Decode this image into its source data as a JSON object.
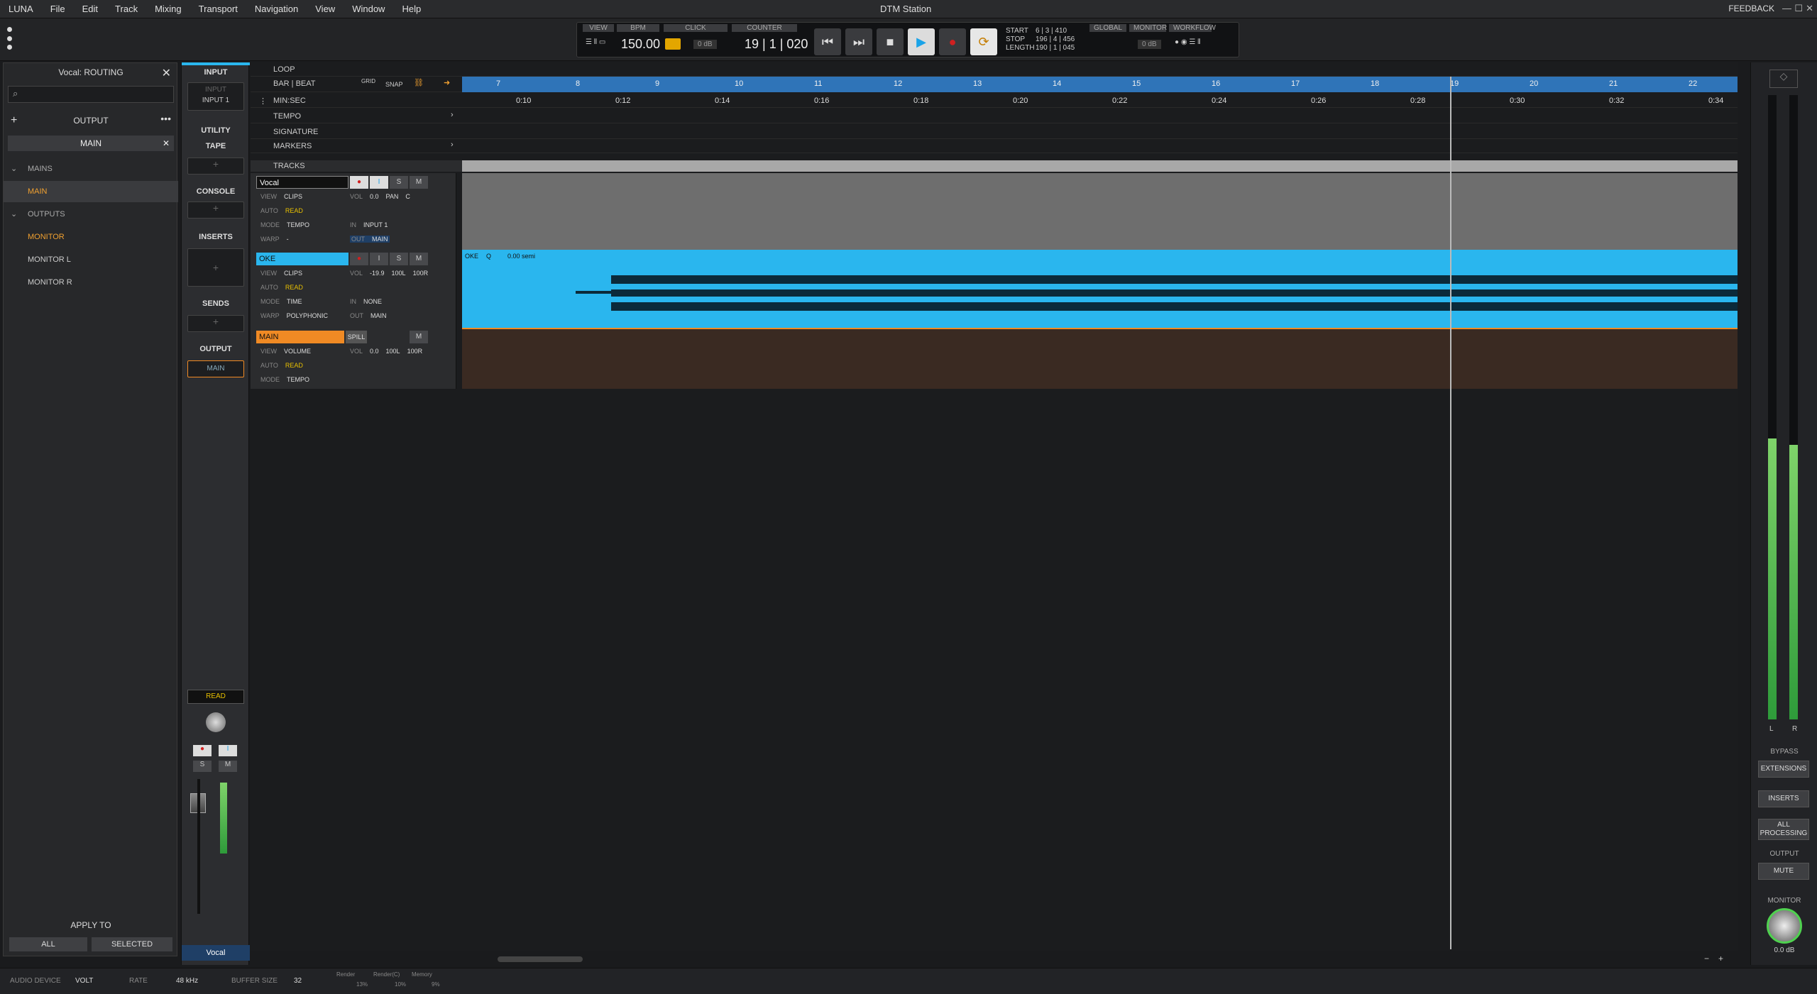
{
  "menu": [
    "LUNA",
    "File",
    "Edit",
    "Track",
    "Mixing",
    "Transport",
    "Navigation",
    "View",
    "Window",
    "Help"
  ],
  "window_title": "DTM Station",
  "feedback": "FEEDBACK",
  "transport": {
    "view": "VIEW",
    "bpm_label": "BPM",
    "bpm": "150.00",
    "click_label": "CLICK",
    "click_db": "0 dB",
    "counter_label": "COUNTER",
    "counter": "19 | 1 | 020",
    "start_label": "START",
    "stop_label": "STOP",
    "length_label": "LENGTH",
    "start": "6 | 3 | 410",
    "stop": "196 | 4 | 456",
    "length": "190 | 1 | 045",
    "global_label": "GLOBAL",
    "monitor_label": "MONITOR",
    "workflow_label": "WORKFLOW",
    "monitor_db": "0 dB"
  },
  "left": {
    "title": "Vocal: ROUTING",
    "output": "OUTPUT",
    "main_sel": "MAIN",
    "mains": "MAINS",
    "main": "MAIN",
    "outputs": "OUTPUTS",
    "monitor": "MONITOR",
    "monitor_l": "MONITOR L",
    "monitor_r": "MONITOR R",
    "apply_to": "APPLY TO",
    "all": "ALL",
    "selected": "SELECTED"
  },
  "strip": {
    "input": "INPUT",
    "input_slot": "INPUT",
    "input1": "INPUT 1",
    "utility": "UTILITY",
    "tape": "TAPE",
    "console": "CONSOLE",
    "inserts": "INSERTS",
    "sends": "SENDS",
    "output": "OUTPUT",
    "out_main": "MAIN",
    "read": "READ",
    "name": "Vocal"
  },
  "rulers": {
    "loop": "LOOP",
    "barbeat": "BAR | BEAT",
    "grid": "GRID",
    "snap": "SNAP",
    "minsec": "MIN:SEC",
    "tempo": "TEMPO",
    "signature": "SIGNATURE",
    "markers": "MARKERS",
    "tracks": "TRACKS"
  },
  "bars": [
    "7",
    "8",
    "9",
    "10",
    "11",
    "12",
    "13",
    "14",
    "15",
    "16",
    "17",
    "18",
    "19",
    "20",
    "21",
    "22"
  ],
  "times": [
    "0:10",
    "0:12",
    "0:14",
    "0:16",
    "0:18",
    "0:20",
    "0:22",
    "0:24",
    "0:26",
    "0:28",
    "0:30",
    "0:32",
    "0:34"
  ],
  "tracks": [
    {
      "name": "Vocal",
      "color": "#ffffff",
      "view": "CLIPS",
      "auto": "READ",
      "mode": "TEMPO",
      "warp": "-",
      "vol": "0.0",
      "pan": "PAN",
      "panval": "C",
      "in": "INPUT 1",
      "out": "MAIN"
    },
    {
      "name": "OKE",
      "color": "#2ab6ee",
      "view": "CLIPS",
      "auto": "READ",
      "mode": "TIME",
      "warp": "POLYPHONIC",
      "vol": "-19.9",
      "panl": "100L",
      "panr": "100R",
      "in": "NONE",
      "out": "MAIN",
      "clip_name": "OKE",
      "clip_q": "Q",
      "clip_pitch": "0.00 semi"
    },
    {
      "name": "MAIN",
      "color": "#f08a24",
      "spill": "SPILL",
      "view": "VOLUME",
      "auto": "READ",
      "mode": "TEMPO",
      "vol": "0.0",
      "panl": "100L",
      "panr": "100R"
    }
  ],
  "right": {
    "bypass": "BYPASS",
    "extensions": "EXTENSIONS",
    "inserts": "INSERTS",
    "all_processing": "ALL PROCESSING",
    "output": "OUTPUT",
    "mute": "MUTE",
    "monitor": "MONITOR",
    "monitor_db": "0.0 dB",
    "l": "L",
    "r": "R"
  },
  "status": {
    "audio_device_label": "AUDIO DEVICE",
    "audio_device": "VOLT",
    "rate_label": "RATE",
    "rate": "48 kHz",
    "buffer_label": "BUFFER SIZE",
    "buffer": "32",
    "render": "Render",
    "renderc": "Render(C)",
    "memory": "Memory",
    "render_pct": "13%",
    "renderc_pct": "10%",
    "memory_pct": "9%"
  }
}
